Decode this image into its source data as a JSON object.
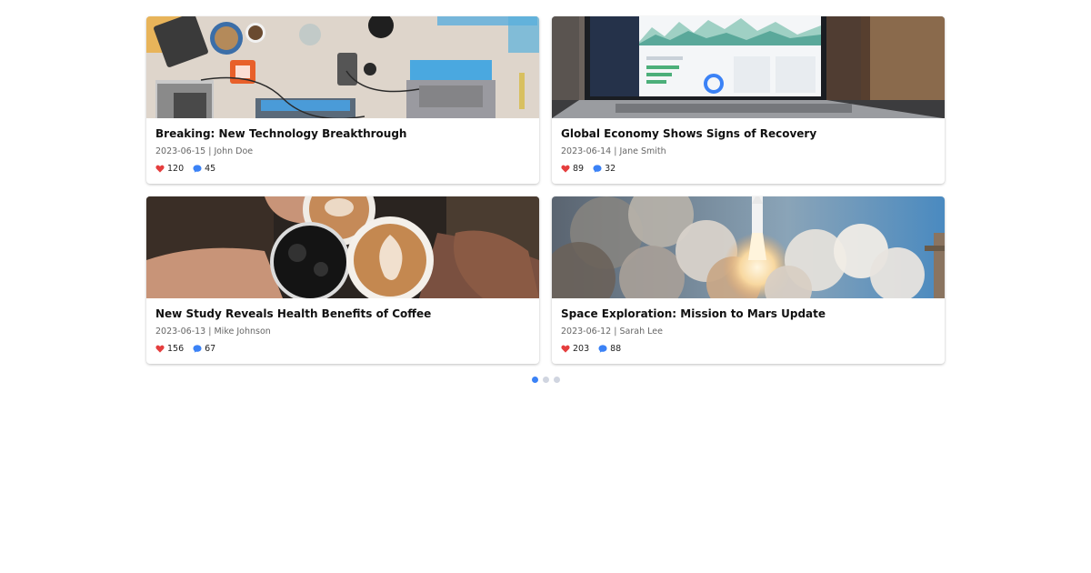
{
  "articles": [
    {
      "title": "Breaking: New Technology Breakthrough",
      "date": "2023-06-15",
      "author": "John Doe",
      "likes": "120",
      "comments": "45",
      "image": "desk-workspace-photo"
    },
    {
      "title": "Global Economy Shows Signs of Recovery",
      "date": "2023-06-14",
      "author": "Jane Smith",
      "likes": "89",
      "comments": "32",
      "image": "laptop-dashboard-photo"
    },
    {
      "title": "New Study Reveals Health Benefits of Coffee",
      "date": "2023-06-13",
      "author": "Mike Johnson",
      "likes": "156",
      "comments": "67",
      "image": "coffee-cups-photo"
    },
    {
      "title": "Space Exploration: Mission to Mars Update",
      "date": "2023-06-12",
      "author": "Sarah Lee",
      "likes": "203",
      "comments": "88",
      "image": "rocket-launch-photo"
    }
  ],
  "meta_separator": "|",
  "icons": {
    "like": "heart-icon",
    "comment": "comment-bubble-icon"
  },
  "colors": {
    "heart": "#e53e3e",
    "comment": "#3b82f6",
    "dot_active": "#3b82f6",
    "dot_inactive": "#d0d5e0"
  },
  "pagination": {
    "total_pages": 3,
    "current_page": 1
  }
}
